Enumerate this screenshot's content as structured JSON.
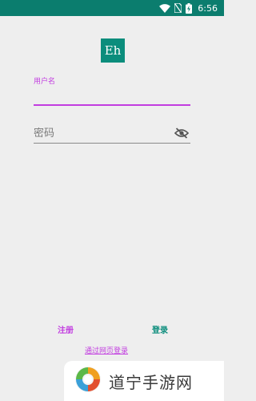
{
  "status_bar": {
    "time": "6:56",
    "icons": [
      "wifi-icon",
      "no-sim-icon",
      "battery-charging-icon"
    ],
    "background": "#0b7d6e"
  },
  "app": {
    "logo_text": "Eh",
    "accent_color": "#0b8d7c",
    "highlight_color": "#c23de0"
  },
  "form": {
    "username_label": "用户名",
    "username_value": "",
    "password_placeholder": "密码",
    "password_value": "",
    "visibility_icon": "visibility-off-icon"
  },
  "actions": {
    "register_label": "注册",
    "login_label": "登录",
    "web_login_label": "通过网页登录"
  },
  "watermark": {
    "text": "道宁手游网",
    "logo_icon": "swirl-logo-icon"
  }
}
